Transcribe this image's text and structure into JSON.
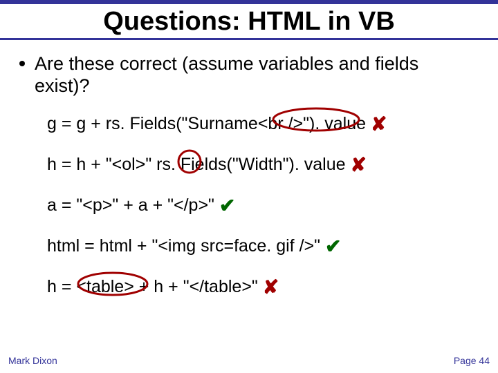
{
  "title": "Questions: HTML in VB",
  "bullet": "Are these correct (assume variables and fields exist)?",
  "lines": {
    "l1": "g = g + rs. Fields(\"Surname<br />\"). value",
    "l2": "h = h + \"<ol>\" rs. Fields(\"Width\"). value",
    "l3": "a = \"<p>\" + a + \"</p>\"",
    "l4": "html = html + \"<img src=face. gif />\"",
    "l5": "h = <table> + h + \"</table>\""
  },
  "marks": {
    "cross": "✘",
    "tick": "✔"
  },
  "footer": {
    "author": "Mark Dixon",
    "page": "Page 44"
  }
}
